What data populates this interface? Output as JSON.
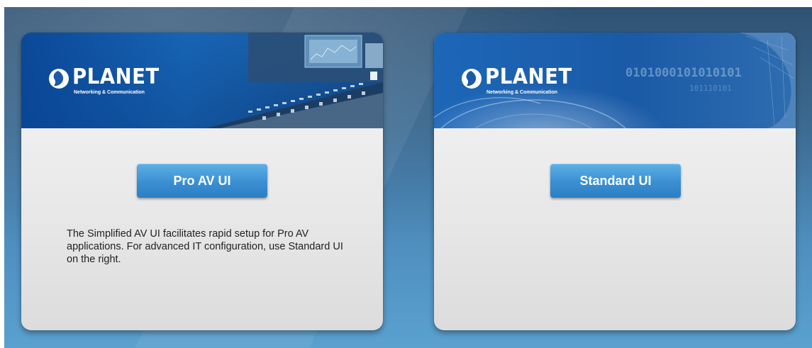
{
  "colors": {
    "button_top": "#5fb0e7",
    "button_bottom": "#2c7ec3",
    "banner_blue": "#1a5aa6",
    "page_bg_top": "#2f5273",
    "page_bg_bottom": "#5aa1cf"
  },
  "left_card": {
    "logo": {
      "wordmark": "PLANET",
      "tagline": "Networking & Communication"
    },
    "button_label": "Pro AV UI",
    "description": "The Simplified AV UI facilitates rapid setup for Pro AV applications. For advanced IT configuration, use Standard UI on the right."
  },
  "right_card": {
    "logo": {
      "wordmark": "PLANET",
      "tagline": "Networking & Communication"
    },
    "button_label": "Standard UI",
    "binary_text": "0101000101010101 101110101"
  }
}
